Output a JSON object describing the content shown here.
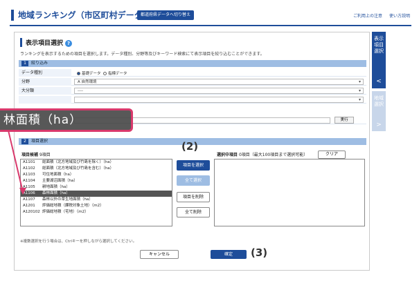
{
  "header": {
    "title": "地域ランキング（市区町村データ）",
    "return_label": "都道府県データへ切り替え",
    "links": [
      "ご利用上の注意",
      "使い方説明"
    ]
  },
  "section": {
    "title": "表示項目選択",
    "description": "ランキングを表示するための項目を選択します。データ種別、分野等及びキーワード検索にて表示項目を絞り込むことができます。"
  },
  "filter": {
    "bar_label": "絞り込み",
    "bar_num": "1",
    "rows": [
      {
        "label": "データ種別",
        "options": [
          "基礎データ",
          "指標データ"
        ]
      },
      {
        "label": "分野",
        "value": "A 自然環境"
      },
      {
        "label": "大分類",
        "value": "----"
      },
      {
        "label": "",
        "value": ""
      }
    ],
    "search_button": "実行"
  },
  "items": {
    "bar_label": "項目選択",
    "bar_num": "2",
    "list_label": "項目候補",
    "list_count": "9項目",
    "list": [
      {
        "code": "A1101",
        "name": "総面積（北方地域及び竹島を除く）（ha）"
      },
      {
        "code": "A1102",
        "name": "総面積（北方地域及び竹島を含む）（ha）"
      },
      {
        "code": "A1103",
        "name": "可住地面積（ha）"
      },
      {
        "code": "A1104",
        "name": "主要湖沼面積（ha）"
      },
      {
        "code": "A1105",
        "name": "耕地面積（ha）"
      },
      {
        "code": "A1106",
        "name": "森林面積（ha）",
        "selected": true
      },
      {
        "code": "A1107",
        "name": "森林以外の草生地面積（ha）"
      },
      {
        "code": "A1201",
        "name": "評価総地積（課税対象土地）（m2）"
      },
      {
        "code": "A120102",
        "name": "評価総地積（宅地）（m2）"
      }
    ],
    "selected_label": "選択中項目",
    "selected_count": "0項目（最大100項目まで選択可能）",
    "clear_button": "クリア",
    "note": "※複数選択を行う場合は、Ctrlキーを押しながら選択してください。"
  },
  "buttons": {
    "select": "項目を選択",
    "select_all": "全て選択",
    "remove": "項目を削除",
    "remove_all": "全て削除",
    "cancel": "キャンセル",
    "ok": "確定"
  },
  "side": {
    "tab1": "表示項目選択",
    "tab2": "地域選択"
  },
  "annotations": {
    "callout": "林面積（ha）",
    "label2": "(2)",
    "label3": "(3)"
  }
}
